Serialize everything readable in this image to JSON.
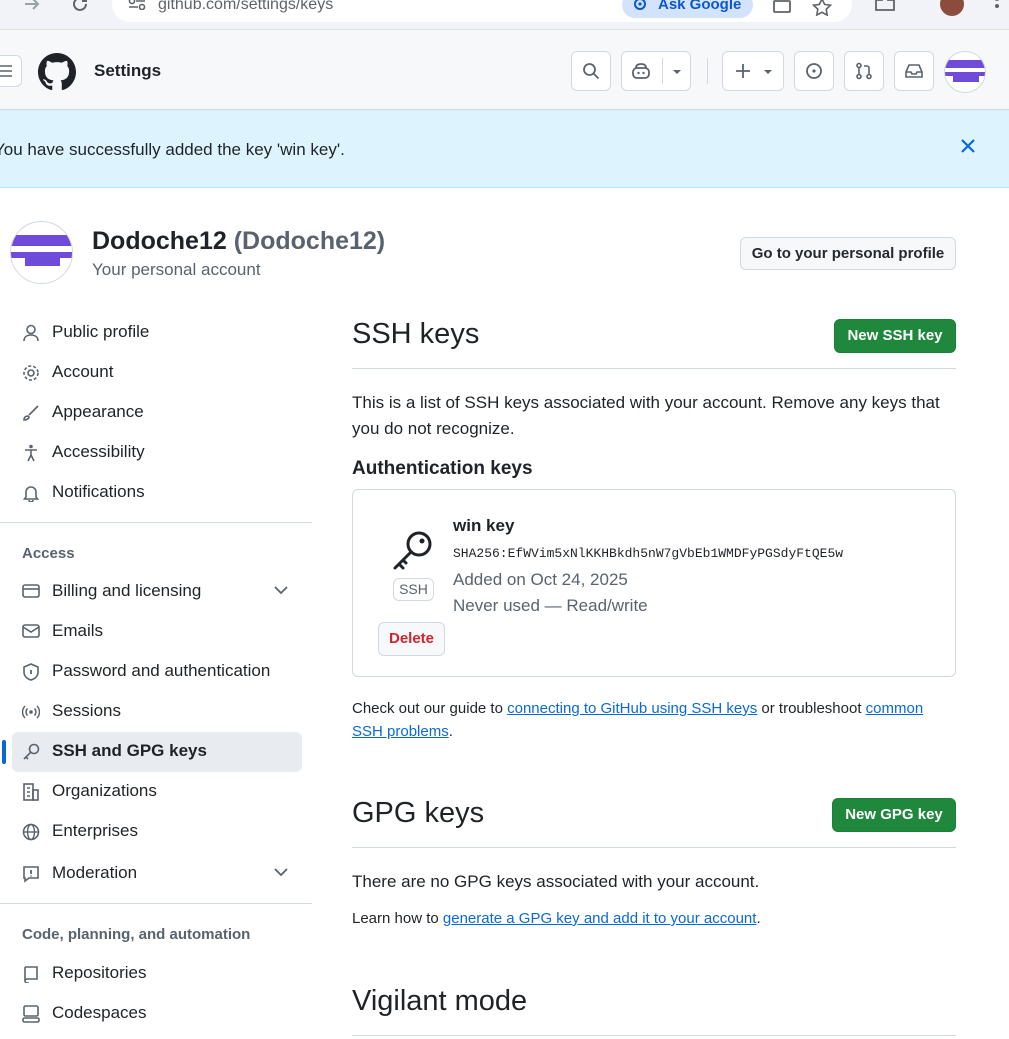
{
  "browser": {
    "url": "github.com/settings/keys",
    "ask_google": "Ask Google"
  },
  "header": {
    "title": "Settings"
  },
  "flash": {
    "message": "You have successfully added the key 'win key'."
  },
  "profile": {
    "name": "Dodoche12",
    "login": "(Dodoche12)",
    "subtitle": "Your personal account",
    "go_button": "Go to your personal profile"
  },
  "sidebar": {
    "items": [
      {
        "label": "Public profile",
        "icon": "person-icon"
      },
      {
        "label": "Account",
        "icon": "gear-icon"
      },
      {
        "label": "Appearance",
        "icon": "paintbrush-icon"
      },
      {
        "label": "Accessibility",
        "icon": "accessibility-icon"
      },
      {
        "label": "Notifications",
        "icon": "bell-icon"
      }
    ],
    "access_heading": "Access",
    "access_items": [
      {
        "label": "Billing and licensing",
        "icon": "credit-card-icon",
        "expandable": true
      },
      {
        "label": "Emails",
        "icon": "mail-icon"
      },
      {
        "label": "Password and authentication",
        "icon": "shield-lock-icon"
      },
      {
        "label": "Sessions",
        "icon": "broadcast-icon"
      },
      {
        "label": "SSH and GPG keys",
        "icon": "key-icon",
        "active": true
      },
      {
        "label": "Organizations",
        "icon": "organization-icon"
      },
      {
        "label": "Enterprises",
        "icon": "globe-icon"
      },
      {
        "label": "Moderation",
        "icon": "report-icon",
        "expandable": true
      }
    ],
    "code_heading": "Code, planning, and automation",
    "code_items": [
      {
        "label": "Repositories",
        "icon": "repo-icon"
      },
      {
        "label": "Codespaces",
        "icon": "codespaces-icon"
      }
    ]
  },
  "ssh": {
    "title": "SSH keys",
    "new_button": "New SSH key",
    "description": "This is a list of SSH keys associated with your account. Remove any keys that you do not recognize.",
    "auth_heading": "Authentication keys",
    "key": {
      "title": "win key",
      "fingerprint": "SHA256:EfWVim5xNlKKHBkdh5nW7gVbEb1WMDFyPGSdyFtQE5w",
      "added": "Added on Oct 24, 2025",
      "usage": "Never used — Read/write",
      "tag": "SSH",
      "delete_label": "Delete"
    },
    "guide_prefix": "Check out our guide to ",
    "guide_link": "connecting to GitHub using SSH keys",
    "guide_middle": " or troubleshoot ",
    "guide_link2": "common SSH problems",
    "guide_suffix": "."
  },
  "gpg": {
    "title": "GPG keys",
    "new_button": "New GPG key",
    "empty": "There are no GPG keys associated with your account.",
    "learn_prefix": "Learn how to ",
    "learn_link": "generate a GPG key and add it to your account",
    "learn_suffix": "."
  },
  "vigilant": {
    "title": "Vigilant mode"
  },
  "colors": {
    "accent": "#0969da",
    "green": "#1f883d",
    "danger": "#d1242f",
    "flash_bg": "#ddf4ff",
    "avatar_purple": "#6e4bd8"
  }
}
